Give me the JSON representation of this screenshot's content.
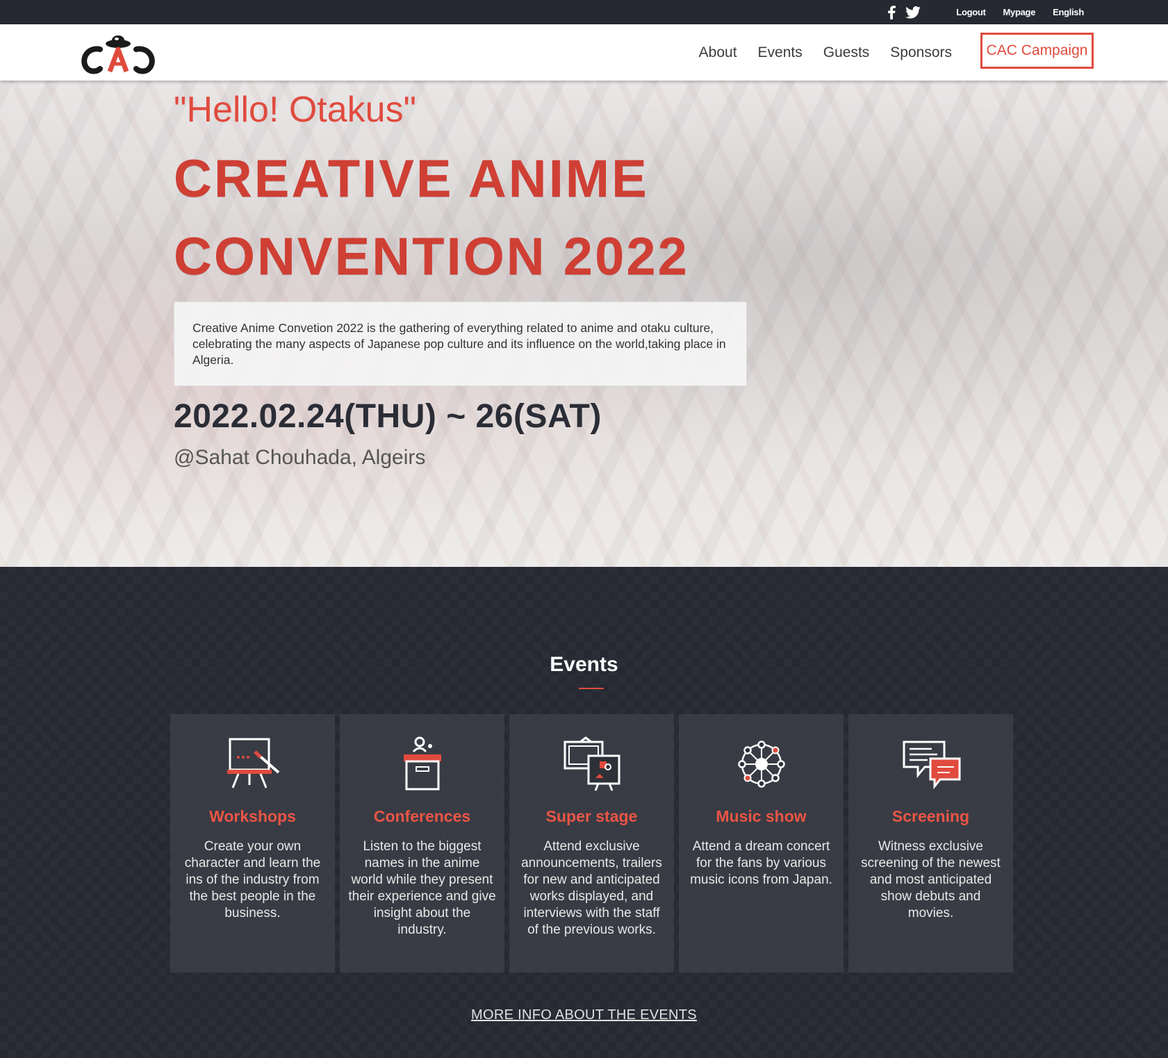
{
  "topbar": {
    "social": [
      "facebook-icon",
      "twitter-icon"
    ],
    "logout": "Logout",
    "mypage": "Mypage",
    "language": "English"
  },
  "nav": {
    "logo_text": "CAC",
    "links": [
      "About",
      "Events",
      "Guests",
      "Sponsors"
    ],
    "cta": "CAC Campaign"
  },
  "hero": {
    "greeting": "\"Hello! Otakus\"",
    "headline_line1": "CREATIVE ANIME",
    "headline_line2": "CONVENTION 2022",
    "description": "Creative Anime Convetion 2022 is the gathering of everything related to anime and otaku culture, celebrating the many aspects of Japanese pop culture and its influence on the world,taking place in Algeria.",
    "dates": "2022.02.24(THU) ~ 26(SAT)",
    "venue": "@Sahat Chouhada, Algeirs"
  },
  "events": {
    "title": "Events",
    "cards": [
      {
        "icon": "whiteboard-icon",
        "title": "Workshops",
        "text": "Create your own character and learn the ins of the industry from the best people in the business."
      },
      {
        "icon": "podium-icon",
        "title": "Conferences",
        "text": "Listen to the biggest names in the anime world while they present their experience and give insight about the industry."
      },
      {
        "icon": "screens-icon",
        "title": "Super stage",
        "text": "Attend exclusive announcements, trailers for new and anticipated works displayed, and interviews with the staff of the previous works."
      },
      {
        "icon": "network-icon",
        "title": "Music show",
        "text": "Attend a dream concert for the fans by various music icons from Japan."
      },
      {
        "icon": "chat-bubbles-icon",
        "title": "Screening",
        "text": "Witness exclusive screening of the newest and most anticipated show debuts and movies."
      }
    ],
    "more_link": "MORE INFO ABOUT THE EVENTS"
  },
  "colors": {
    "accent": "#e04b3e",
    "dark": "#262932"
  }
}
